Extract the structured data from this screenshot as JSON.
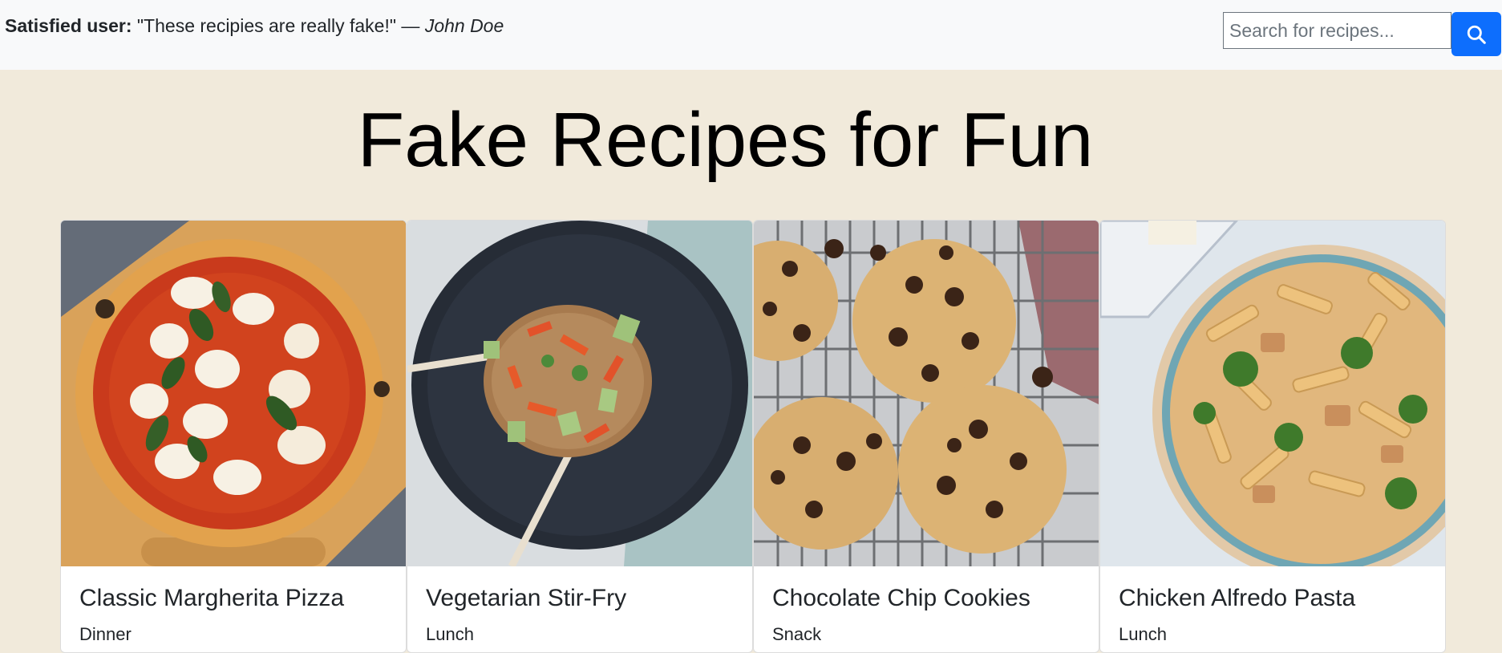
{
  "testimonial": {
    "lead": "Satisfied user:",
    "quote": "\"These recipies are really fake!\"",
    "dash": " — ",
    "author": "John Doe"
  },
  "search": {
    "placeholder": "Search for recipes...",
    "icon": "search-icon",
    "button_color": "#0d6efd"
  },
  "title": "Fake Recipes for Fun",
  "recipes": [
    {
      "name": "Classic Margherita Pizza",
      "category": "Dinner"
    },
    {
      "name": "Vegetarian Stir-Fry",
      "category": "Lunch"
    },
    {
      "name": "Chocolate Chip Cookies",
      "category": "Snack"
    },
    {
      "name": "Chicken Alfredo Pasta",
      "category": "Lunch"
    }
  ]
}
